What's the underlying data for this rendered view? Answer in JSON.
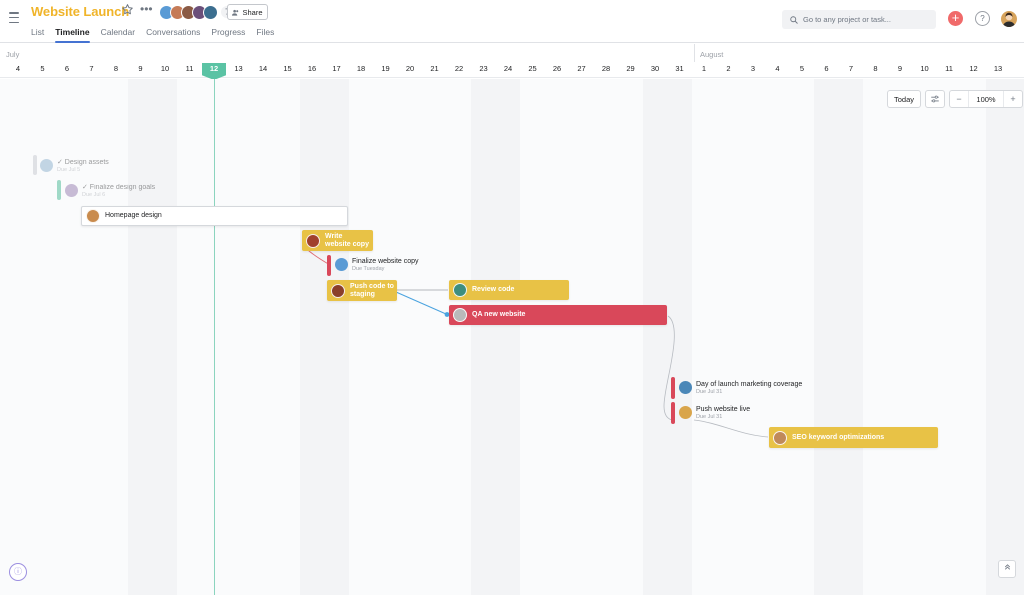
{
  "project": {
    "title": "Website Launch",
    "member_count": "7",
    "share_label": "Share"
  },
  "tabs": [
    {
      "label": "List"
    },
    {
      "label": "Timeline",
      "active": true
    },
    {
      "label": "Calendar"
    },
    {
      "label": "Conversations"
    },
    {
      "label": "Progress"
    },
    {
      "label": "Files"
    }
  ],
  "search": {
    "placeholder": "Go to any project or task..."
  },
  "timeline": {
    "months": [
      "July",
      "August"
    ],
    "july_days": [
      "4",
      "5",
      "6",
      "7",
      "8",
      "9",
      "10",
      "11",
      "12",
      "13",
      "14",
      "15",
      "16",
      "17",
      "18",
      "19",
      "20",
      "21",
      "22",
      "23",
      "24",
      "25",
      "26",
      "27",
      "28",
      "29",
      "30",
      "31"
    ],
    "august_days": [
      "1",
      "2",
      "3",
      "4",
      "5",
      "6",
      "7",
      "8",
      "9",
      "10",
      "11",
      "12",
      "13"
    ],
    "today": "12"
  },
  "controls": {
    "today_label": "Today",
    "zoom_minus": "−",
    "zoom_value": "100%",
    "zoom_plus": "+"
  },
  "tasks": {
    "design_assets": {
      "name": "✓ Design assets",
      "due": "Due Jul 5"
    },
    "finalize_goals": {
      "name": "✓ Finalize design goals",
      "due": "Due Jul 6"
    },
    "homepage_design": {
      "name": "Homepage design"
    },
    "write_copy": {
      "name": "Write website copy"
    },
    "finalize_copy": {
      "name": "Finalize website copy",
      "due": "Due Tuesday"
    },
    "push_staging": {
      "name": "Push code to staging"
    },
    "review_code": {
      "name": "Review code"
    },
    "qa_website": {
      "name": "QA new website"
    },
    "launch_marketing": {
      "name": "Day of launch marketing coverage",
      "due": "Due Jul 31"
    },
    "push_live": {
      "name": "Push website live",
      "due": "Due Jul 31"
    },
    "seo": {
      "name": "SEO keyword optimizations"
    }
  },
  "colors": {
    "brand_title": "#f0b429",
    "today": "#5bc3a4",
    "yellow_task": "#e8c246",
    "red_task": "#d9485a",
    "accent_tab": "#4573d2"
  }
}
